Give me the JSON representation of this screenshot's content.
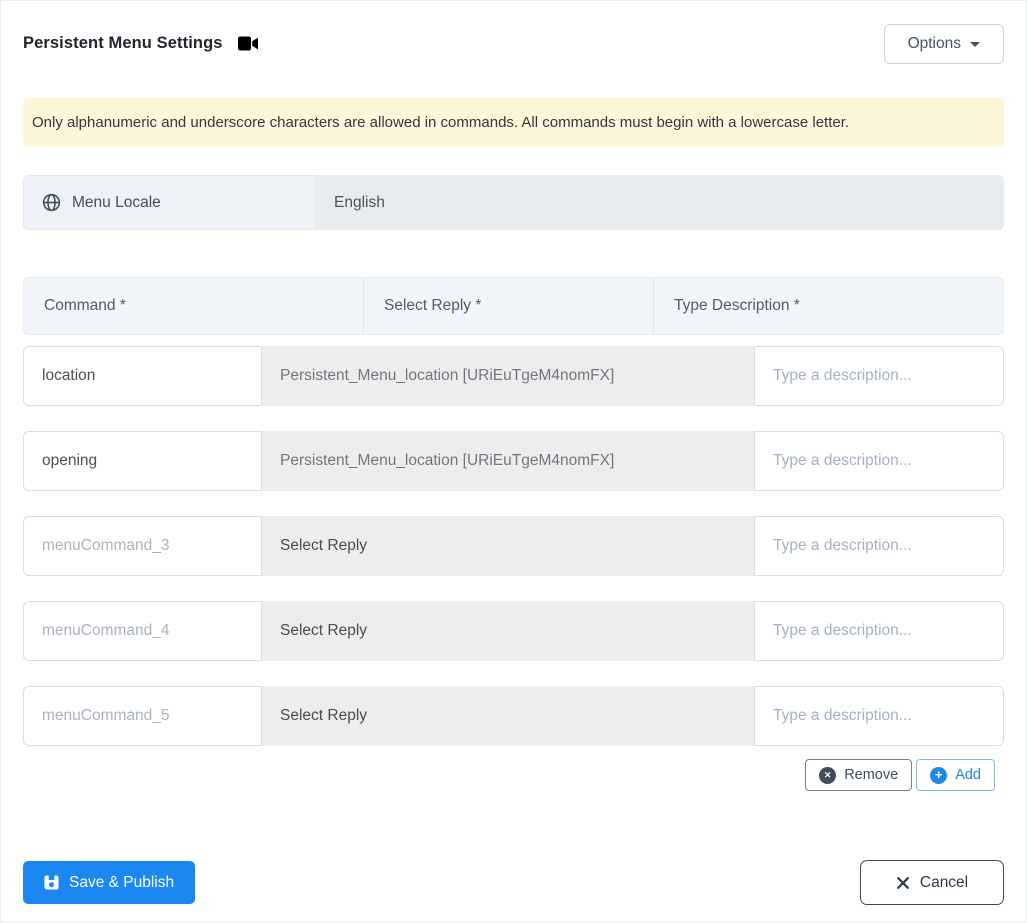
{
  "header": {
    "title": "Persistent Menu Settings",
    "options_label": "Options"
  },
  "alert": {
    "text": "Only alphanumeric and underscore characters are allowed in commands. All commands must begin with a lowercase letter."
  },
  "locale": {
    "label": "Menu Locale",
    "value": "English"
  },
  "table": {
    "columns": [
      "Command *",
      "Select Reply *",
      "Type Description *"
    ],
    "rows": [
      {
        "command_value": "location",
        "reply": "Persistent_Menu_location [URiEuTgeM4nomFX]",
        "reply_state": "selected",
        "description_placeholder": "Type a description..."
      },
      {
        "command_value": "opening",
        "reply": "Persistent_Menu_location [URiEuTgeM4nomFX]",
        "reply_state": "selected",
        "description_placeholder": "Type a description..."
      },
      {
        "command_placeholder": "menuCommand_3",
        "reply": "Select Reply",
        "reply_state": "empty",
        "description_placeholder": "Type a description..."
      },
      {
        "command_placeholder": "menuCommand_4",
        "reply": "Select Reply",
        "reply_state": "empty",
        "description_placeholder": "Type a description..."
      },
      {
        "command_placeholder": "menuCommand_5",
        "reply": "Select Reply",
        "reply_state": "empty",
        "description_placeholder": "Type a description..."
      }
    ]
  },
  "actions": {
    "remove_label": "Remove",
    "add_label": "Add"
  },
  "footer": {
    "save_label": "Save & Publish",
    "cancel_label": "Cancel"
  },
  "colors": {
    "primary_blue": "#1b87f0",
    "add_blue": "#1e88e5",
    "alert_bg": "#fdf6d9",
    "reply_bg": "#ededed",
    "table_header_bg": "#f2f5fa"
  }
}
